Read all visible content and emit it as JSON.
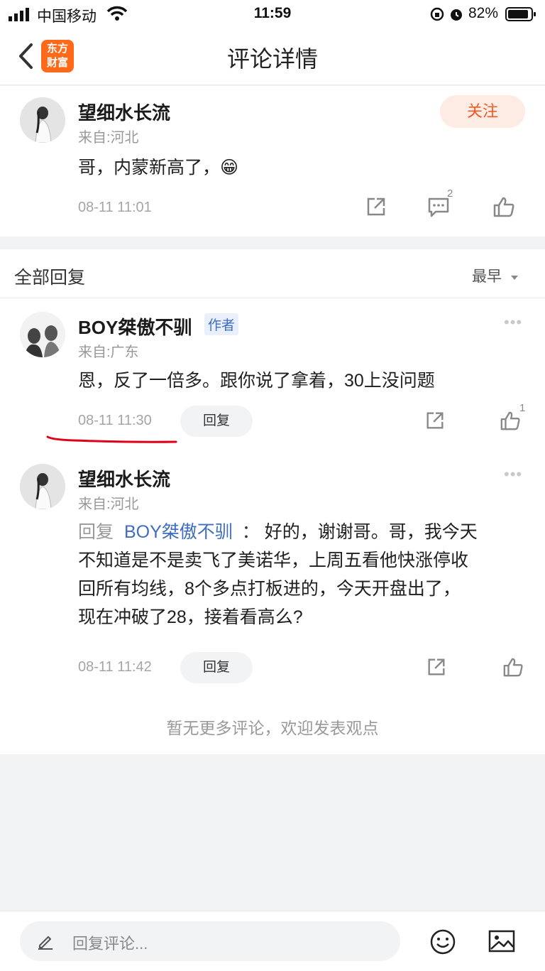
{
  "status": {
    "carrier": "中国移动",
    "time": "11:59",
    "battery": "82%"
  },
  "nav": {
    "title": "评论详情",
    "logo_line1": "东方",
    "logo_line2": "财富"
  },
  "main_comment": {
    "user": "望细水长流",
    "location": "来自:河北",
    "follow": "关注",
    "text": "哥，内蒙新高了，😁",
    "time": "08-11 11:01",
    "comment_count": "2"
  },
  "replies_header": {
    "title": "全部回复",
    "sort": "最早"
  },
  "replies": [
    {
      "user": "BOY桀傲不驯",
      "tag": "作者",
      "location": "来自:广东",
      "text": "恩，反了一倍多。跟你说了拿着，30上没问题",
      "time": "08-11 11:30",
      "reply_label": "回复",
      "like_count": "1"
    },
    {
      "user": "望细水长流",
      "location": "来自:河北",
      "reply_prefix": "回复",
      "reply_to": "BOY桀傲不驯",
      "colon": "：",
      "line1": "好的，谢谢哥。哥，我今天",
      "line2": "不知道是不是卖飞了美诺华，上周五看他快涨停收",
      "line3": "回所有均线，8个多点打板进的，今天开盘出了，",
      "line4": "现在冲破了28，接着看高么?",
      "time": "08-11 11:42",
      "reply_label": "回复"
    }
  ],
  "end_text": "暂无更多评论，欢迎发表观点",
  "bottom": {
    "placeholder": "回复评论..."
  },
  "colors": {
    "accent": "#ff6a1a",
    "link": "#3f6dbf",
    "annotation": "#e0001a"
  }
}
